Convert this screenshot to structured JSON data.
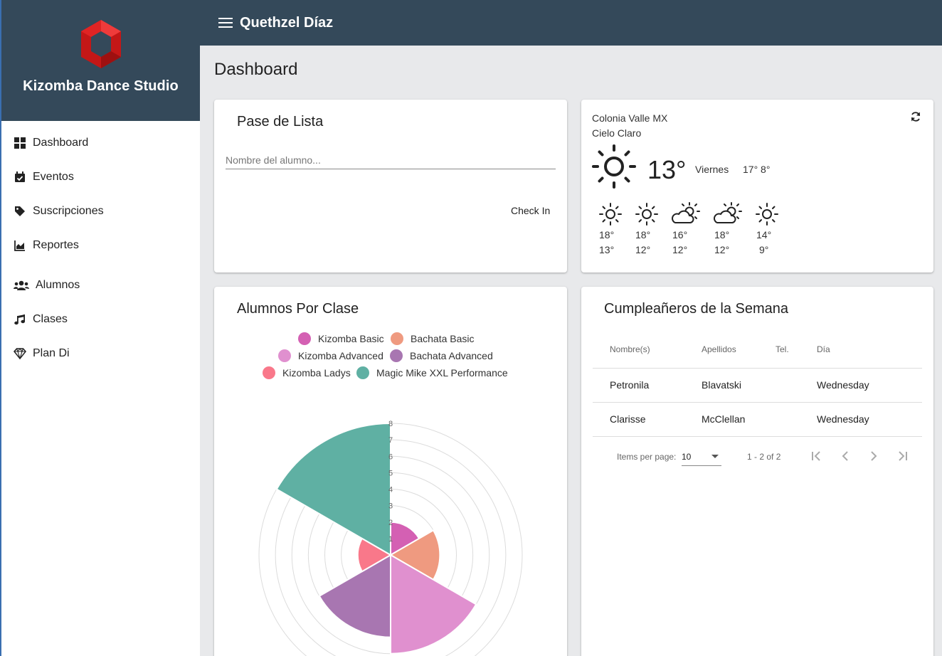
{
  "brand": {
    "name": "Kizomba Dance Studio",
    "logo_icon": "red-hexagon-logo",
    "logo_color": "#d32020"
  },
  "topbar": {
    "user_name": "Quethzel Díaz",
    "menu_icon": "hamburger-icon",
    "bg_color": "#34495a"
  },
  "sidebar": {
    "items": [
      {
        "label": "Dashboard",
        "icon": "dashboard-icon"
      },
      {
        "label": "Eventos",
        "icon": "calendar-check-icon"
      },
      {
        "label": "Suscripciones",
        "icon": "tag-icon"
      },
      {
        "label": "Reportes",
        "icon": "area-chart-icon"
      },
      {
        "label": "Alumnos",
        "icon": "users-icon"
      },
      {
        "label": "Clases",
        "icon": "music-note-icon"
      },
      {
        "label": "Plan Di",
        "icon": "diamond-icon"
      }
    ]
  },
  "page": {
    "title": "Dashboard"
  },
  "attendance": {
    "title": "Pase de Lista",
    "input_placeholder": "Nombre del alumno...",
    "input_value": "",
    "button_label": "Check In"
  },
  "weather": {
    "location": "Colonia Valle MX",
    "condition": "Cielo Claro",
    "temp": "13°",
    "day": "Viernes",
    "hi_lo": "17° 8°",
    "forecast": [
      {
        "icon": "sun-icon",
        "hi": "18°",
        "lo": "13°"
      },
      {
        "icon": "sun-icon",
        "hi": "18°",
        "lo": "12°"
      },
      {
        "icon": "partly-cloudy-icon",
        "hi": "16°",
        "lo": "12°"
      },
      {
        "icon": "partly-cloudy-icon",
        "hi": "18°",
        "lo": "12°"
      },
      {
        "icon": "sun-icon",
        "hi": "14°",
        "lo": "9°"
      }
    ]
  },
  "chart_card": {
    "title": "Alumnos Por Clase"
  },
  "chart_data": {
    "type": "polarArea",
    "categories": [
      "Kizomba Basic",
      "Bachata Basic",
      "Kizomba Advanced",
      "Bachata Advanced",
      "Kizomba Ladys",
      "Magic Mike XXL Performance"
    ],
    "values": [
      2,
      3,
      6,
      5,
      2,
      8
    ],
    "colors": [
      "#d460b3",
      "#ef9a80",
      "#e090cf",
      "#a876b1",
      "#f9788a",
      "#5fb0a3"
    ],
    "rlim": [
      0,
      8
    ],
    "ticks": [
      "1",
      "2",
      "3",
      "4",
      "5",
      "6",
      "7",
      "8"
    ],
    "legend_position": "top",
    "grid": true
  },
  "birthdays": {
    "title": "Cumpleañeros de la Semana",
    "columns": [
      "Nombre(s)",
      "Apellidos",
      "Tel.",
      "Día"
    ],
    "rows": [
      [
        "Petronila",
        "Blavatski",
        "",
        "Wednesday"
      ],
      [
        "Clarisse",
        "McClellan",
        "",
        "Wednesday"
      ]
    ],
    "paginator": {
      "items_label": "Items per page:",
      "page_size": "10",
      "range": "1 - 2 of 2"
    }
  }
}
